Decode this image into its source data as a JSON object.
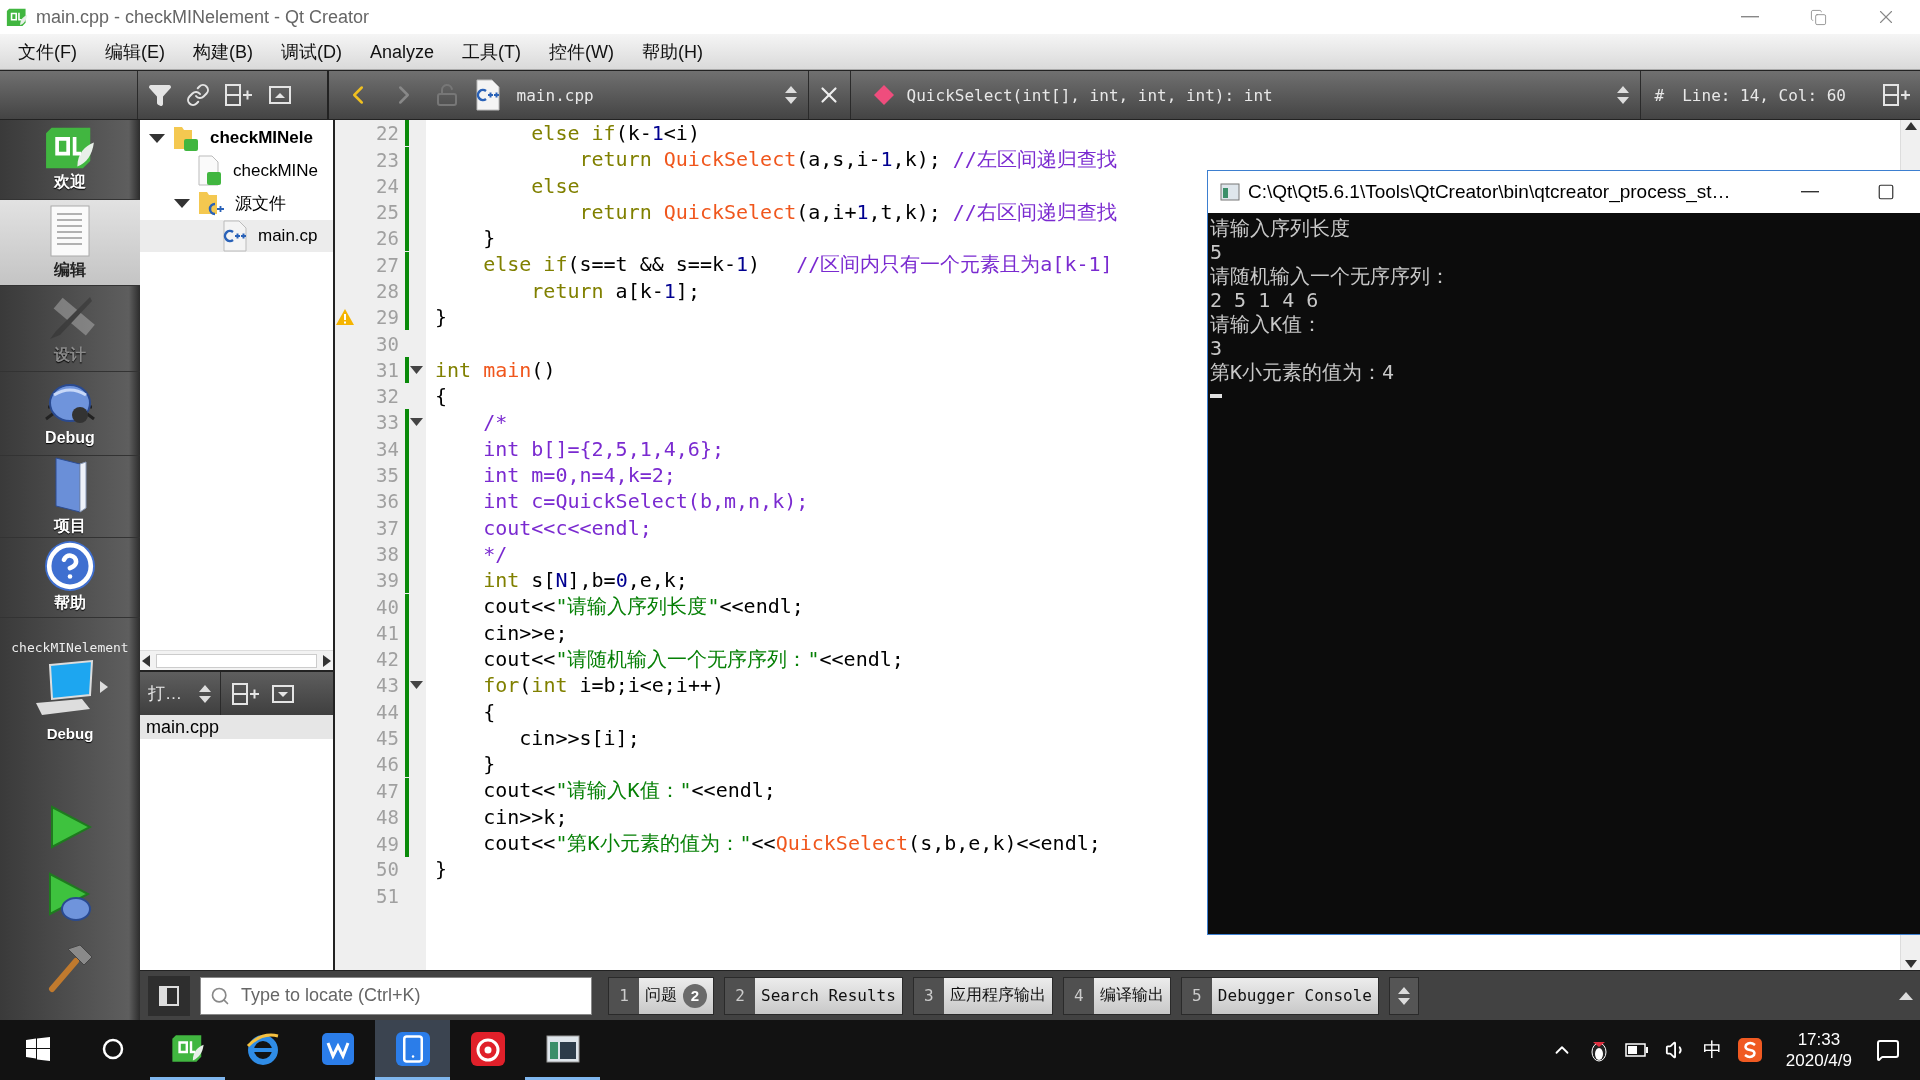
{
  "window": {
    "title": "main.cpp - checkMINelement - Qt Creator"
  },
  "menu": [
    "文件(F)",
    "编辑(E)",
    "构建(B)",
    "调试(D)",
    "Analyze",
    "工具(T)",
    "控件(W)",
    "帮助(H)"
  ],
  "modes": [
    {
      "label": "欢迎",
      "kind": "welcome",
      "selected": false,
      "disabled": false
    },
    {
      "label": "编辑",
      "kind": "edit",
      "selected": true,
      "disabled": false
    },
    {
      "label": "设计",
      "kind": "design",
      "selected": false,
      "disabled": true
    },
    {
      "label": "Debug",
      "kind": "debug",
      "selected": false,
      "disabled": false
    },
    {
      "label": "项目",
      "kind": "projects",
      "selected": false,
      "disabled": false
    },
    {
      "label": "帮助",
      "kind": "help",
      "selected": false,
      "disabled": false
    }
  ],
  "target": {
    "project": "checkMINelement",
    "config": "Debug"
  },
  "run_buttons": [
    {
      "kind": "run"
    },
    {
      "kind": "debug-run"
    },
    {
      "kind": "build"
    }
  ],
  "project_tree": [
    {
      "label": "checkMINele",
      "kind": "project",
      "expanded": true,
      "selected": false,
      "children": [
        {
          "label": "checkMINe",
          "kind": "profile",
          "selected": false
        },
        {
          "label": "源文件",
          "kind": "folder",
          "expanded": true,
          "selected": false,
          "children": [
            {
              "label": "main.cp",
              "kind": "cpp",
              "selected": true
            }
          ]
        }
      ]
    }
  ],
  "open_documents": {
    "combo": "打…",
    "items": [
      {
        "label": "main.cpp",
        "selected": true
      }
    ]
  },
  "editor": {
    "file": "main.cpp",
    "symbol": "QuickSelect(int[], int, int, int): int",
    "hash": "#",
    "position": "Line: 14, Col: 60",
    "lines": [
      {
        "number": "22",
        "changed": true,
        "fold": false,
        "warning": false,
        "tokens": [
          {
            "kind": "kw",
            "text": "        else"
          },
          {
            "kind": "kw",
            "text": " if"
          },
          {
            "kind": "txt",
            "text": "(k-"
          },
          {
            "kind": "num",
            "text": "1"
          },
          {
            "kind": "txt",
            "text": "<i)"
          }
        ]
      },
      {
        "number": "23",
        "changed": true,
        "fold": false,
        "warning": false,
        "tokens": [
          {
            "kind": "kw",
            "text": "            return"
          },
          {
            "kind": "fn",
            "text": " QuickSelect"
          },
          {
            "kind": "txt",
            "text": "(a,s,i-"
          },
          {
            "kind": "num",
            "text": "1"
          },
          {
            "kind": "txt",
            "text": ",k);"
          },
          {
            "kind": "cm",
            "text": " //左区间递归查找"
          }
        ]
      },
      {
        "number": "24",
        "changed": true,
        "fold": false,
        "warning": false,
        "tokens": [
          {
            "kind": "kw",
            "text": "        else"
          }
        ]
      },
      {
        "number": "25",
        "changed": true,
        "fold": false,
        "warning": false,
        "tokens": [
          {
            "kind": "kw",
            "text": "            return"
          },
          {
            "kind": "fn",
            "text": " QuickSelect"
          },
          {
            "kind": "txt",
            "text": "(a,i+"
          },
          {
            "kind": "num",
            "text": "1"
          },
          {
            "kind": "txt",
            "text": ",t,k);"
          },
          {
            "kind": "cm",
            "text": " //右区间递归查找"
          }
        ]
      },
      {
        "number": "26",
        "changed": true,
        "fold": false,
        "warning": false,
        "tokens": [
          {
            "kind": "txt",
            "text": "    }"
          }
        ]
      },
      {
        "number": "27",
        "changed": true,
        "fold": false,
        "warning": false,
        "tokens": [
          {
            "kind": "kw",
            "text": "    else"
          },
          {
            "kind": "kw",
            "text": " if"
          },
          {
            "kind": "txt",
            "text": "(s==t && s==k-"
          },
          {
            "kind": "num",
            "text": "1"
          },
          {
            "kind": "txt",
            "text": ")"
          },
          {
            "kind": "cm",
            "text": "   //区间内只有一个元素且为a[k-1]"
          }
        ]
      },
      {
        "number": "28",
        "changed": true,
        "fold": false,
        "warning": false,
        "tokens": [
          {
            "kind": "kw",
            "text": "        return"
          },
          {
            "kind": "txt",
            "text": " a[k-"
          },
          {
            "kind": "num",
            "text": "1"
          },
          {
            "kind": "txt",
            "text": "];"
          }
        ]
      },
      {
        "number": "29",
        "changed": true,
        "fold": false,
        "warning": true,
        "tokens": [
          {
            "kind": "txt",
            "text": "}"
          }
        ]
      },
      {
        "number": "30",
        "changed": false,
        "fold": false,
        "warning": false
      },
      {
        "number": "31",
        "changed": true,
        "fold": true,
        "warning": false,
        "tokens": [
          {
            "kind": "kw",
            "text": "int"
          },
          {
            "kind": "fn",
            "text": " main"
          },
          {
            "kind": "txt",
            "text": "()"
          }
        ]
      },
      {
        "number": "32",
        "changed": false,
        "fold": false,
        "warning": false,
        "tokens": [
          {
            "kind": "txt",
            "text": "{"
          }
        ]
      },
      {
        "number": "33",
        "changed": true,
        "fold": true,
        "warning": false,
        "tokens": [
          {
            "kind": "cm",
            "text": "    /*"
          }
        ]
      },
      {
        "number": "34",
        "changed": true,
        "fold": false,
        "warning": false,
        "tokens": [
          {
            "kind": "cm",
            "text": "    int b[]={2,5,1,4,6};"
          }
        ]
      },
      {
        "number": "35",
        "changed": true,
        "fold": false,
        "warning": false,
        "tokens": [
          {
            "kind": "cm",
            "text": "    int m=0,n=4,k=2;"
          }
        ]
      },
      {
        "number": "36",
        "changed": true,
        "fold": false,
        "warning": false,
        "tokens": [
          {
            "kind": "cm",
            "text": "    int c=QuickSelect(b,m,n,k);"
          }
        ]
      },
      {
        "number": "37",
        "changed": true,
        "fold": false,
        "warning": false,
        "tokens": [
          {
            "kind": "cm",
            "text": "    cout<<c<<endl;"
          }
        ]
      },
      {
        "number": "38",
        "changed": true,
        "fold": false,
        "warning": false,
        "tokens": [
          {
            "kind": "cm",
            "text": "    */"
          }
        ]
      },
      {
        "number": "39",
        "changed": true,
        "fold": false,
        "warning": false,
        "tokens": [
          {
            "kind": "kw",
            "text": "    int"
          },
          {
            "kind": "txt",
            "text": " s["
          },
          {
            "kind": "macro",
            "text": "N"
          },
          {
            "kind": "txt",
            "text": "],b="
          },
          {
            "kind": "num",
            "text": "0"
          },
          {
            "kind": "txt",
            "text": ",e,k;"
          }
        ]
      },
      {
        "number": "40",
        "changed": true,
        "fold": false,
        "warning": false,
        "tokens": [
          {
            "kind": "txt",
            "text": "    cout<<"
          },
          {
            "kind": "str",
            "text": "\"请输入序列长度\""
          },
          {
            "kind": "txt",
            "text": "<<endl;"
          }
        ]
      },
      {
        "number": "41",
        "changed": true,
        "fold": false,
        "warning": false,
        "tokens": [
          {
            "kind": "txt",
            "text": "    cin>>e;"
          }
        ]
      },
      {
        "number": "42",
        "changed": true,
        "fold": false,
        "warning": false,
        "tokens": [
          {
            "kind": "txt",
            "text": "    cout<<"
          },
          {
            "kind": "str",
            "text": "\"请随机输入一个无序序列：\""
          },
          {
            "kind": "txt",
            "text": "<<endl;"
          }
        ]
      },
      {
        "number": "43",
        "changed": true,
        "fold": true,
        "warning": false,
        "tokens": [
          {
            "kind": "kw",
            "text": "    for"
          },
          {
            "kind": "txt",
            "text": "("
          },
          {
            "kind": "kw",
            "text": "int"
          },
          {
            "kind": "txt",
            "text": " i=b;i<e;i++)"
          }
        ]
      },
      {
        "number": "44",
        "changed": true,
        "fold": false,
        "warning": false,
        "tokens": [
          {
            "kind": "txt",
            "text": "    {"
          }
        ]
      },
      {
        "number": "45",
        "changed": true,
        "fold": false,
        "warning": false,
        "tokens": [
          {
            "kind": "txt",
            "text": "       cin>>s[i];"
          }
        ]
      },
      {
        "number": "46",
        "changed": true,
        "fold": false,
        "warning": false,
        "tokens": [
          {
            "kind": "txt",
            "text": "    }"
          }
        ]
      },
      {
        "number": "47",
        "changed": true,
        "fold": false,
        "warning": false,
        "tokens": [
          {
            "kind": "txt",
            "text": "    cout<<"
          },
          {
            "kind": "str",
            "text": "\"请输入K值：\""
          },
          {
            "kind": "txt",
            "text": "<<endl;"
          }
        ]
      },
      {
        "number": "48",
        "changed": true,
        "fold": false,
        "warning": false,
        "tokens": [
          {
            "kind": "txt",
            "text": "    cin>>k;"
          }
        ]
      },
      {
        "number": "49",
        "changed": true,
        "fold": false,
        "warning": false,
        "tokens": [
          {
            "kind": "txt",
            "text": "    cout<<"
          },
          {
            "kind": "str",
            "text": "\"第K小元素的值为：\""
          },
          {
            "kind": "txt",
            "text": "<<"
          },
          {
            "kind": "fn",
            "text": "QuickSelect"
          },
          {
            "kind": "txt",
            "text": "(s,b,e,k)<<endl;"
          }
        ]
      },
      {
        "number": "50",
        "changed": false,
        "fold": false,
        "warning": false,
        "tokens": [
          {
            "kind": "txt",
            "text": "}"
          }
        ]
      },
      {
        "number": "51",
        "changed": false,
        "fold": false,
        "warning": false
      }
    ]
  },
  "console": {
    "title": "C:\\Qt\\Qt5.6.1\\Tools\\QtCreator\\bin\\qtcreator_process_st…",
    "lines": [
      "请输入序列长度",
      "5",
      "请随机输入一个无序序列：",
      "2 5 1 4 6",
      "请输入K值：",
      "3",
      "第K小元素的值为：4"
    ],
    "cursor": true
  },
  "output_bar": {
    "search": {
      "placeholder": "Type to locate (Ctrl+K)"
    },
    "panes": [
      {
        "number": "1",
        "label": "问题",
        "badge": "2"
      },
      {
        "number": "2",
        "label": "Search Results"
      },
      {
        "number": "3",
        "label": "应用程序输出"
      },
      {
        "number": "4",
        "label": "编译输出"
      },
      {
        "number": "5",
        "label": "Debugger Console"
      }
    ]
  },
  "taskbar": {
    "apps": [
      {
        "kind": "start",
        "running": false,
        "selected": false
      },
      {
        "kind": "search",
        "running": false,
        "selected": false
      },
      {
        "kind": "qt",
        "running": true,
        "selected": false
      },
      {
        "kind": "browser",
        "running": false,
        "selected": false
      },
      {
        "kind": "writer",
        "running": false,
        "selected": false
      },
      {
        "kind": "phone",
        "running": true,
        "selected": true
      },
      {
        "kind": "music",
        "running": false,
        "selected": false
      },
      {
        "kind": "console",
        "running": true,
        "selected": false
      }
    ],
    "tray": {
      "ime": "中",
      "time": "17:33",
      "date": "2020/4/9"
    }
  }
}
